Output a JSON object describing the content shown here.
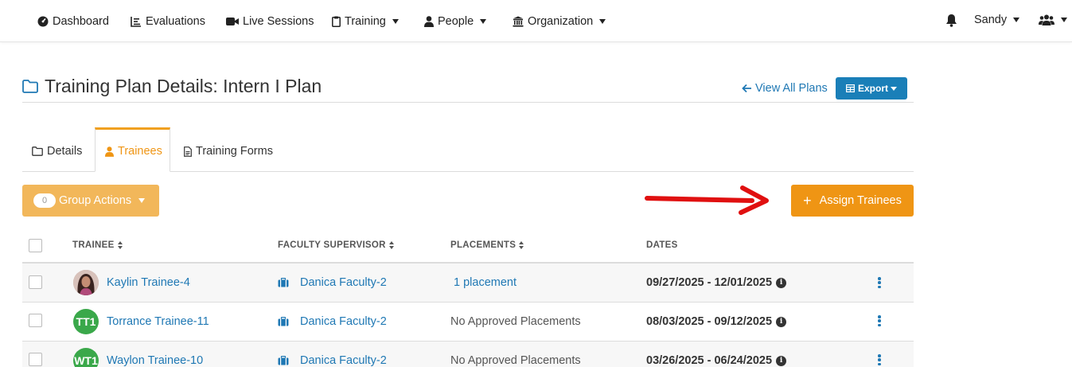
{
  "nav": {
    "items": [
      {
        "label": "Dashboard",
        "icon": "dashboard-gauge-icon"
      },
      {
        "label": "Evaluations",
        "icon": "chart-list-icon"
      },
      {
        "label": "Live Sessions",
        "icon": "video-camera-icon"
      },
      {
        "label": "Training",
        "icon": "clipboard-icon"
      },
      {
        "label": "People",
        "icon": "person-icon"
      },
      {
        "label": "Organization",
        "icon": "building-columns-icon"
      }
    ],
    "user_name": "Sandy"
  },
  "header": {
    "title": "Training Plan Details: Intern I Plan",
    "view_all_label": "View All Plans",
    "export_label": "Export"
  },
  "tabs": [
    {
      "label": "Details"
    },
    {
      "label": "Trainees"
    },
    {
      "label": "Training Forms"
    }
  ],
  "actions": {
    "group_count": "0",
    "group_label": "Group Actions",
    "assign_label": "Assign Trainees"
  },
  "table": {
    "columns": [
      "TRAINEE",
      "FACULTY SUPERVISOR",
      "PLACEMENTS",
      "DATES"
    ],
    "rows": [
      {
        "initials": "",
        "trainee": "Kaylin Trainee-4",
        "supervisor": "Danica Faculty-2",
        "placements": "1 placement",
        "dates": "09/27/2025 - 12/01/2025"
      },
      {
        "initials": "TT1",
        "trainee": "Torrance Trainee-11",
        "supervisor": "Danica Faculty-2",
        "placements": "No Approved Placements",
        "dates": "08/03/2025 - 09/12/2025"
      },
      {
        "initials": "WT1",
        "trainee": "Waylon Trainee-10",
        "supervisor": "Danica Faculty-2",
        "placements": "No Approved Placements",
        "dates": "03/26/2025 - 06/24/2025"
      }
    ]
  },
  "colors": {
    "link": "#1f78b4",
    "accent_orange": "#ef9514",
    "group_actions": "#f2b75a",
    "export": "#1a7fb8",
    "avatar_green": "#3aa84a",
    "annotation_arrow": "#e01010"
  }
}
